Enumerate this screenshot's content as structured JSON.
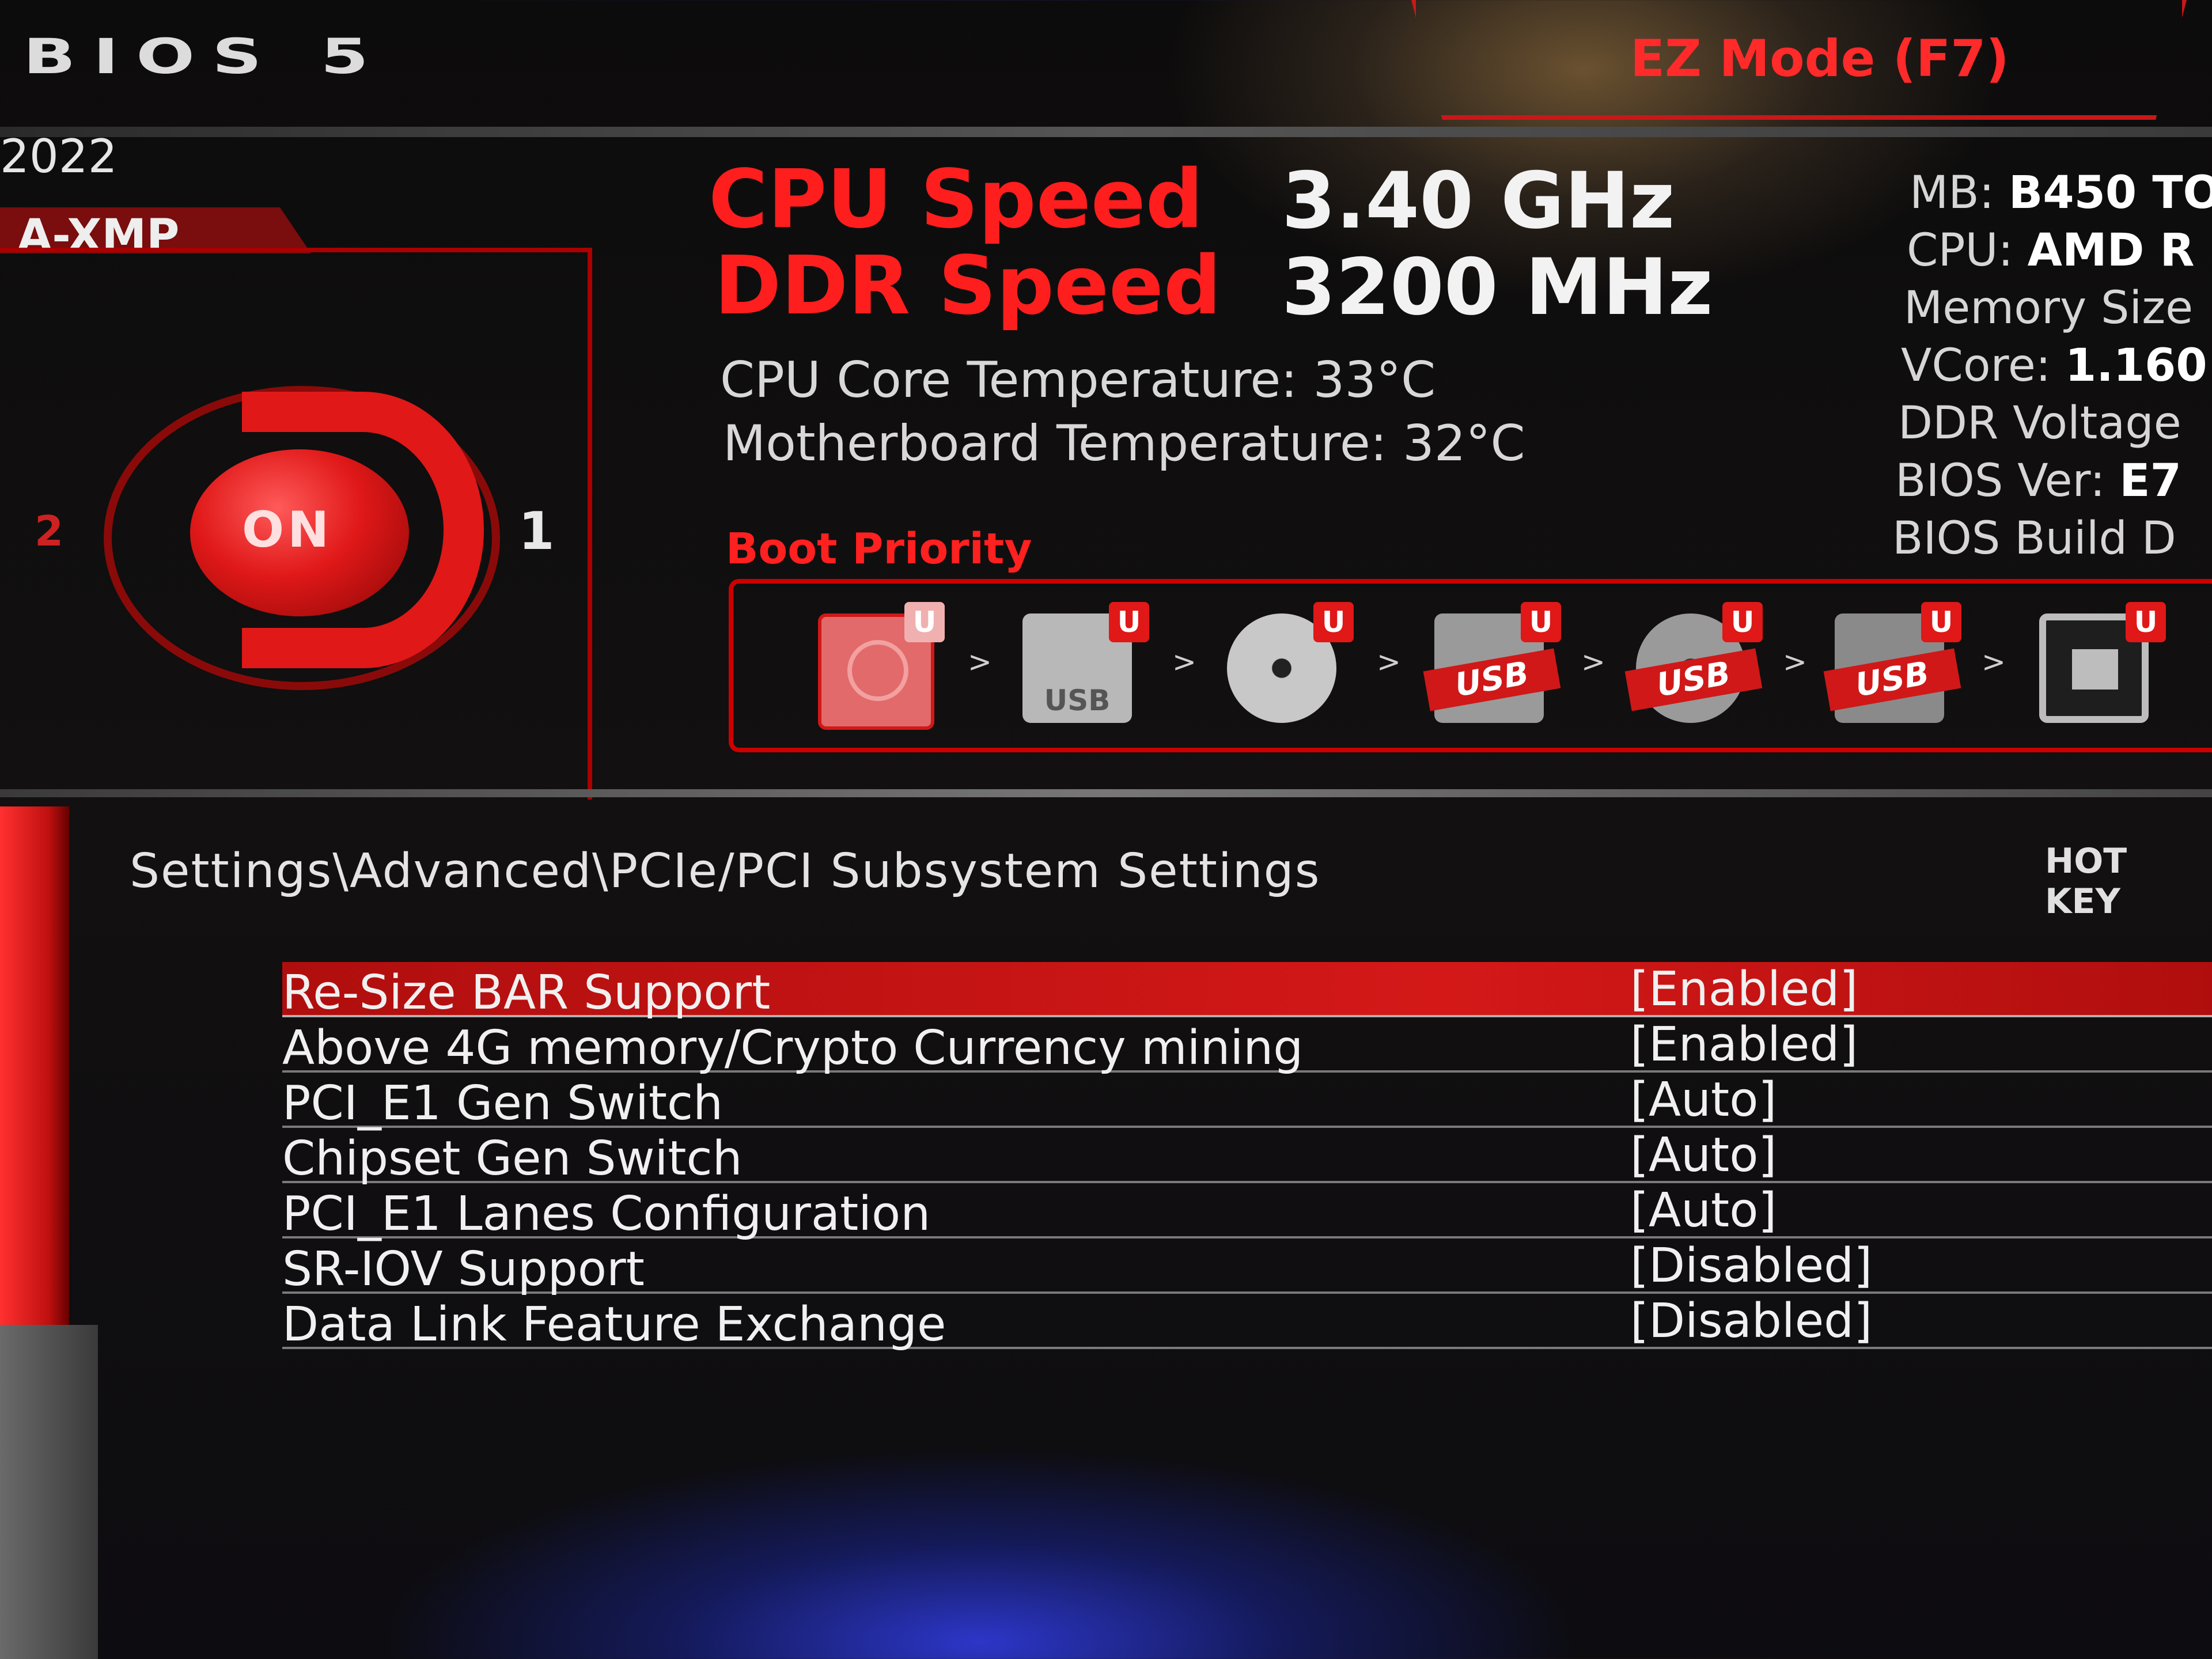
{
  "header": {
    "logo": "BIOS 5",
    "mode_button": "EZ Mode (F7)"
  },
  "left_panel": {
    "date": "2022",
    "profile_tab": "A-XMP",
    "xmp_knob": {
      "state": "ON",
      "left_profile": "2",
      "right_profile": "1"
    }
  },
  "info": {
    "cpu_speed_label": "CPU Speed",
    "cpu_speed_value": "3.40 GHz",
    "ddr_speed_label": "DDR Speed",
    "ddr_speed_value": "3200 MHz",
    "cpu_core_temp": "CPU Core Temperature: 33°C",
    "mb_temp": "Motherboard Temperature: 32°C"
  },
  "system_info": [
    {
      "label": "MB: ",
      "value": "B450 TO"
    },
    {
      "label": "CPU: ",
      "value": "AMD R"
    },
    {
      "label": "Memory Size",
      "value": ""
    },
    {
      "label": "VCore: ",
      "value": "1.160"
    },
    {
      "label": "DDR Voltage",
      "value": ""
    },
    {
      "label": "BIOS Ver: ",
      "value": "E7"
    },
    {
      "label": "BIOS Build D",
      "value": ""
    }
  ],
  "boot_priority": {
    "label": "Boot Priority",
    "devices": [
      {
        "icon": "hard-drive-icon",
        "badge": "U",
        "usb_label": ""
      },
      {
        "icon": "usb-drive-icon",
        "badge": "U",
        "usb_label": "USB"
      },
      {
        "icon": "optical-disc-icon",
        "badge": "U",
        "usb_label": ""
      },
      {
        "icon": "usb-hard-drive-icon",
        "badge": "U",
        "usb_label": "USB"
      },
      {
        "icon": "usb-optical-disc-icon",
        "badge": "U",
        "usb_label": "USB"
      },
      {
        "icon": "usb-floppy-icon",
        "badge": "U",
        "usb_label": "USB"
      },
      {
        "icon": "network-icon",
        "badge": "U",
        "usb_label": ""
      }
    ],
    "arrow": ">"
  },
  "settings": {
    "breadcrumb": "Settings\\Advanced\\PCIe/PCI Subsystem Settings",
    "hotkey": "HOT KEY",
    "rows": [
      {
        "label": "Re-Size BAR Support",
        "value": "[Enabled]",
        "selected": true
      },
      {
        "label": "Above 4G memory/Crypto Currency mining",
        "value": "[Enabled]"
      },
      {
        "label": "PCI_E1 Gen Switch",
        "value": "[Auto]"
      },
      {
        "label": "Chipset Gen Switch",
        "value": "[Auto]"
      },
      {
        "label": "PCI_E1 Lanes Configuration",
        "value": "[Auto]"
      },
      {
        "label": "SR-IOV Support",
        "value": "[Disabled]"
      },
      {
        "label": "Data Link Feature Exchange",
        "value": "[Disabled]"
      }
    ]
  },
  "colors": {
    "accent": "#e01818",
    "selected_row": "#d41818"
  }
}
